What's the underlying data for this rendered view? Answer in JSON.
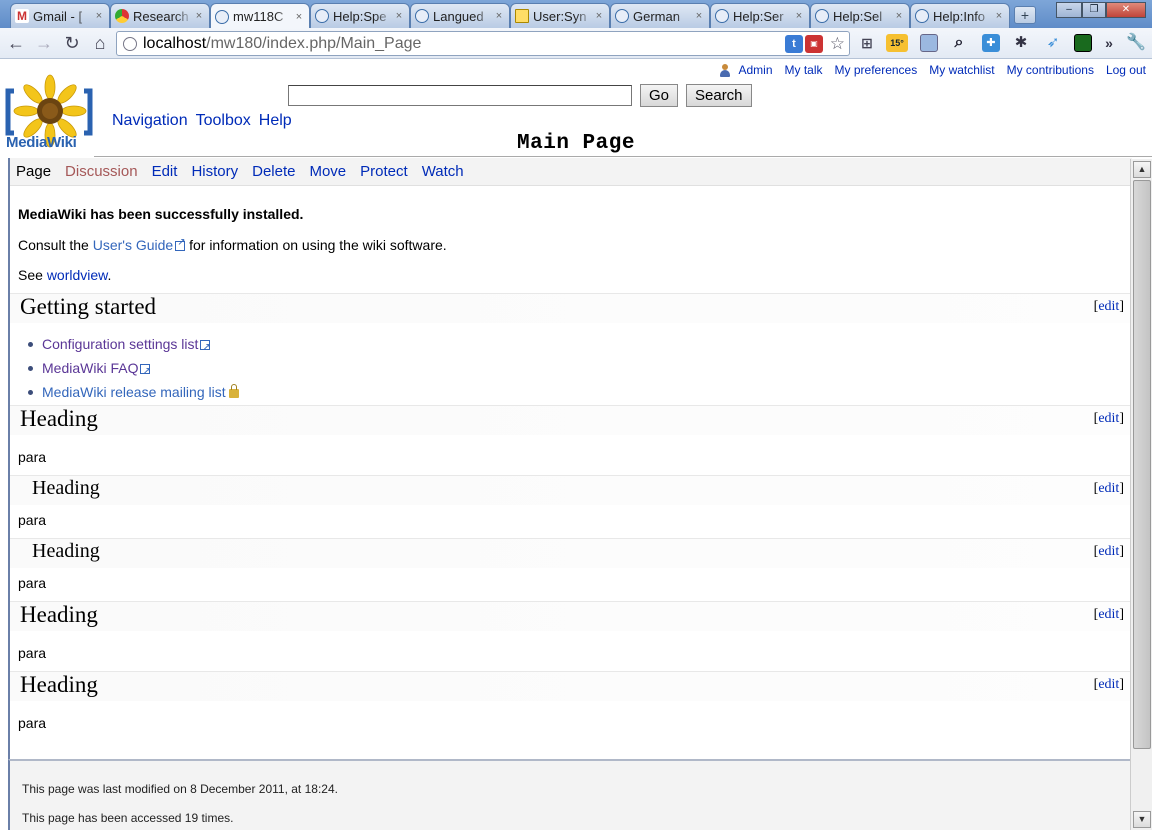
{
  "browser": {
    "tabs": [
      {
        "title": "Gmail - [",
        "icon": "gmail-icon"
      },
      {
        "title": "Research",
        "icon": "chrome-icon"
      },
      {
        "title": "mw118C",
        "icon": "globe-icon",
        "active": true
      },
      {
        "title": "Help:Spe",
        "icon": "globe-icon"
      },
      {
        "title": "Langued",
        "icon": "globe-icon"
      },
      {
        "title": "User:Syn",
        "icon": "user-page-icon"
      },
      {
        "title": "German",
        "icon": "globe-icon"
      },
      {
        "title": "Help:Ser",
        "icon": "globe-icon"
      },
      {
        "title": "Help:Sel",
        "icon": "globe-icon"
      },
      {
        "title": "Help:Info",
        "icon": "globe-icon"
      }
    ],
    "new_tab": "+",
    "close_glyph": "×",
    "window_controls": {
      "minimize": "–",
      "restore": "❐",
      "close": "✕"
    },
    "url_host": "localhost",
    "url_path": "/mw180/index.php/Main_Page",
    "weather_badge": "15°",
    "overflow": "»"
  },
  "wiki": {
    "personal_links": [
      "Admin",
      "My talk",
      "My preferences",
      "My watchlist",
      "My contributions",
      "Log out"
    ],
    "logo_text": "MediaWiki",
    "search": {
      "value": "",
      "go_label": "Go",
      "search_label": "Search"
    },
    "top_nav": [
      "Navigation",
      "Toolbox",
      "Help"
    ],
    "page_title": "Main Page",
    "actions": {
      "page": "Page",
      "discussion": "Discussion",
      "edit": "Edit",
      "history": "History",
      "delete": "Delete",
      "move": "Move",
      "protect": "Protect",
      "watch": "Watch"
    },
    "intro": {
      "installed": "MediaWiki has been successfully installed.",
      "consult_prefix": "Consult the ",
      "users_guide": "User's Guide",
      "consult_suffix": " for information on using the wiki software.",
      "see_prefix": "See ",
      "worldview": "worldview",
      "see_suffix": "."
    },
    "edit_label": "edit",
    "bracket_open": "[",
    "bracket_close": "]",
    "getting_started": {
      "heading": "Getting started",
      "links": [
        "Configuration settings list",
        "MediaWiki FAQ",
        "MediaWiki release mailing list"
      ]
    },
    "sections": [
      {
        "heading": "Heading",
        "para": "para"
      },
      {
        "heading": "Heading",
        "para": "para"
      },
      {
        "heading": "Heading",
        "para": "para"
      },
      {
        "heading": "Heading",
        "para": "para"
      },
      {
        "heading": "Heading",
        "para": "para"
      }
    ],
    "footer": {
      "last_modified": "This page was last modified on 8 December 2011, at 18:24.",
      "accessed": "This page has been accessed 19 times."
    }
  },
  "colors": {
    "link": "#002bb8",
    "external_link": "#3366bb",
    "new_link": "#a55858",
    "logo_blue": "#2a62b0"
  }
}
